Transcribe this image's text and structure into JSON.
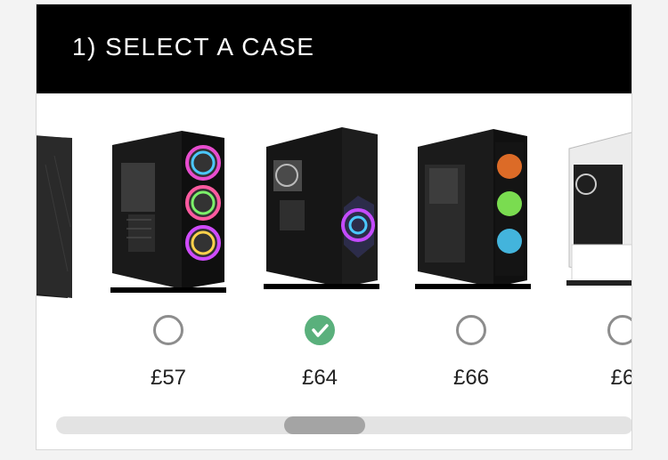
{
  "header": {
    "title": "1) SELECT A CASE"
  },
  "cases": [
    {
      "icon": "pc-case-partial-image",
      "selected": false,
      "price": ""
    },
    {
      "icon": "pc-case-image",
      "selected": false,
      "price": "£57"
    },
    {
      "icon": "pc-case-image",
      "selected": true,
      "price": "£64"
    },
    {
      "icon": "pc-case-image",
      "selected": false,
      "price": "£66"
    },
    {
      "icon": "pc-case-partial-image",
      "selected": false,
      "price": "£6"
    }
  ],
  "scrollbar": {
    "position": 0.46,
    "visible_fraction": 0.14
  },
  "colors": {
    "header_bg": "#000000",
    "selected": "#5ab07c",
    "radio_border": "#8d8d8d"
  }
}
